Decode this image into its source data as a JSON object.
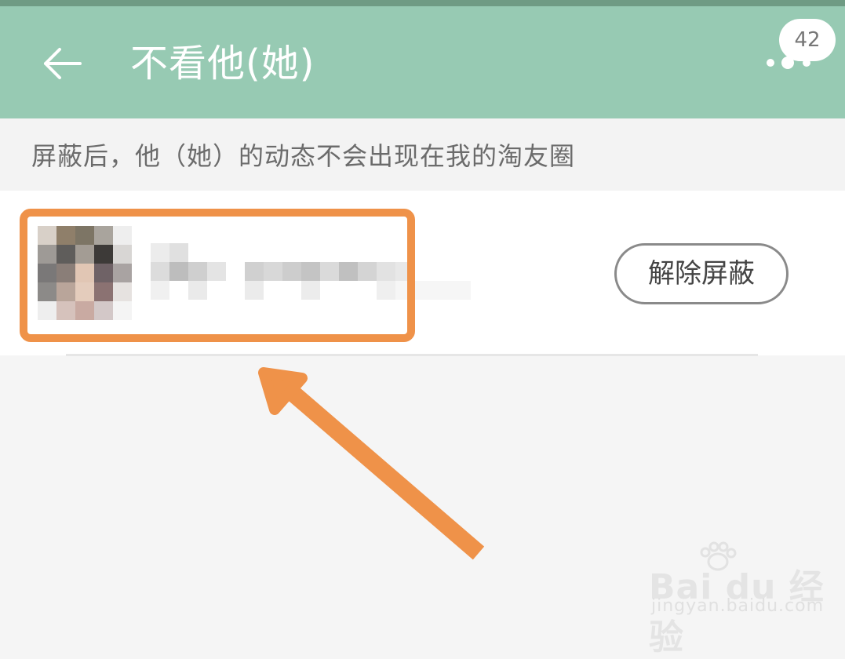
{
  "header": {
    "title": "不看他(她)",
    "badge_count": "42"
  },
  "notice": {
    "text": "屏蔽后，他（她）的动态不会出现在我的淘友圈"
  },
  "blocked_list": {
    "items": [
      {
        "unblock_label": "解除屏蔽"
      }
    ]
  },
  "watermark": {
    "brand": "Bai du 经验",
    "url": "jingyan.baidu.com"
  },
  "colors": {
    "header_bg": "#97cab3",
    "highlight": "#ef9249",
    "page_bg": "#f5f5f5"
  },
  "icons": {
    "back": "arrow-left-icon",
    "more": "more-dots-icon"
  }
}
